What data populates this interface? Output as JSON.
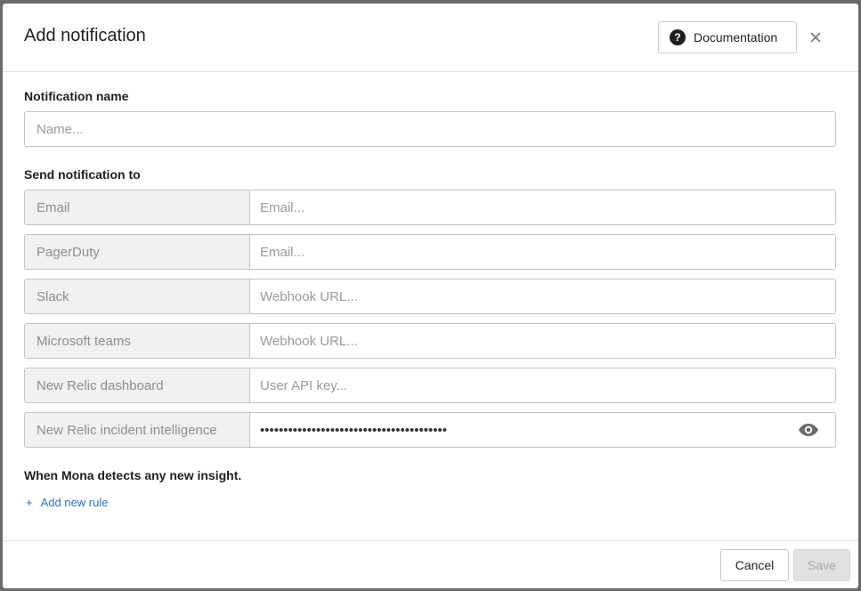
{
  "dialog": {
    "title": "Add notification",
    "documentation_label": "Documentation",
    "close_label": "×"
  },
  "name_section": {
    "label": "Notification name",
    "placeholder": "Name..."
  },
  "channels_section": {
    "label": "Send notification to",
    "channels": [
      {
        "label": "Email",
        "placeholder": "Email...",
        "value": ""
      },
      {
        "label": "PagerDuty",
        "placeholder": "Email...",
        "value": ""
      },
      {
        "label": "Slack",
        "placeholder": "Webhook URL...",
        "value": ""
      },
      {
        "label": "Microsoft teams",
        "placeholder": "Webhook URL...",
        "value": ""
      },
      {
        "label": "New Relic dashboard",
        "placeholder": "User API key...",
        "value": ""
      },
      {
        "label": "New Relic incident intelligence",
        "placeholder": "",
        "value": "••••••••••••••••••••••••••••••••••••••••"
      }
    ]
  },
  "rules_section": {
    "label": "When Mona detects any new insight.",
    "add_rule_label": "Add new rule",
    "add_rule_icon": "+"
  },
  "footer": {
    "cancel_label": "Cancel",
    "save_label": "Save"
  },
  "colors": {
    "link": "#2f6fc9",
    "label_bg": "#f1f1f4",
    "border": "#c4c4c4",
    "disabled_bg": "#e1e1e1"
  }
}
